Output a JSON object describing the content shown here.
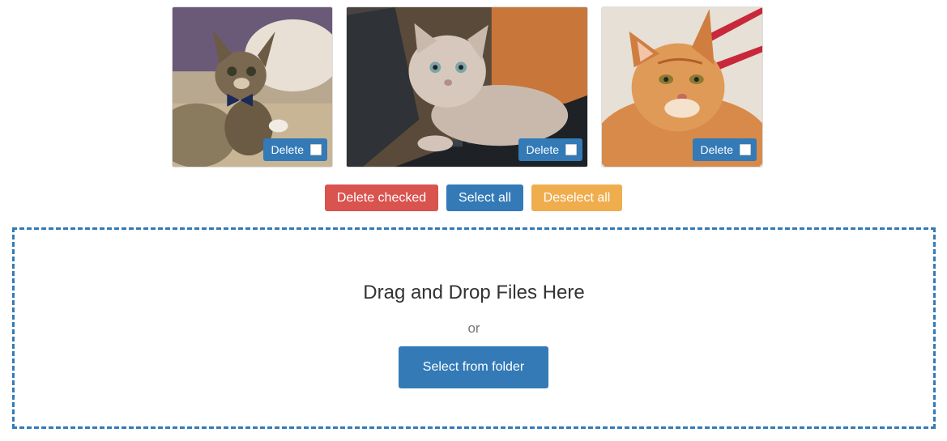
{
  "gallery": {
    "images": [
      {
        "alt": "kitten with bow tie",
        "delete_label": "Delete",
        "checked": false
      },
      {
        "alt": "grey kitten on laptop",
        "delete_label": "Delete",
        "checked": false
      },
      {
        "alt": "orange tabby cat",
        "delete_label": "Delete",
        "checked": false
      }
    ]
  },
  "actions": {
    "delete_checked_label": "Delete checked",
    "select_all_label": "Select all",
    "deselect_all_label": "Deselect all"
  },
  "dropzone": {
    "title": "Drag and Drop Files Here",
    "or_text": "or",
    "select_button_label": "Select from folder"
  },
  "colors": {
    "primary": "#337ab7",
    "danger": "#d9534f",
    "warning": "#f0ad4e"
  }
}
